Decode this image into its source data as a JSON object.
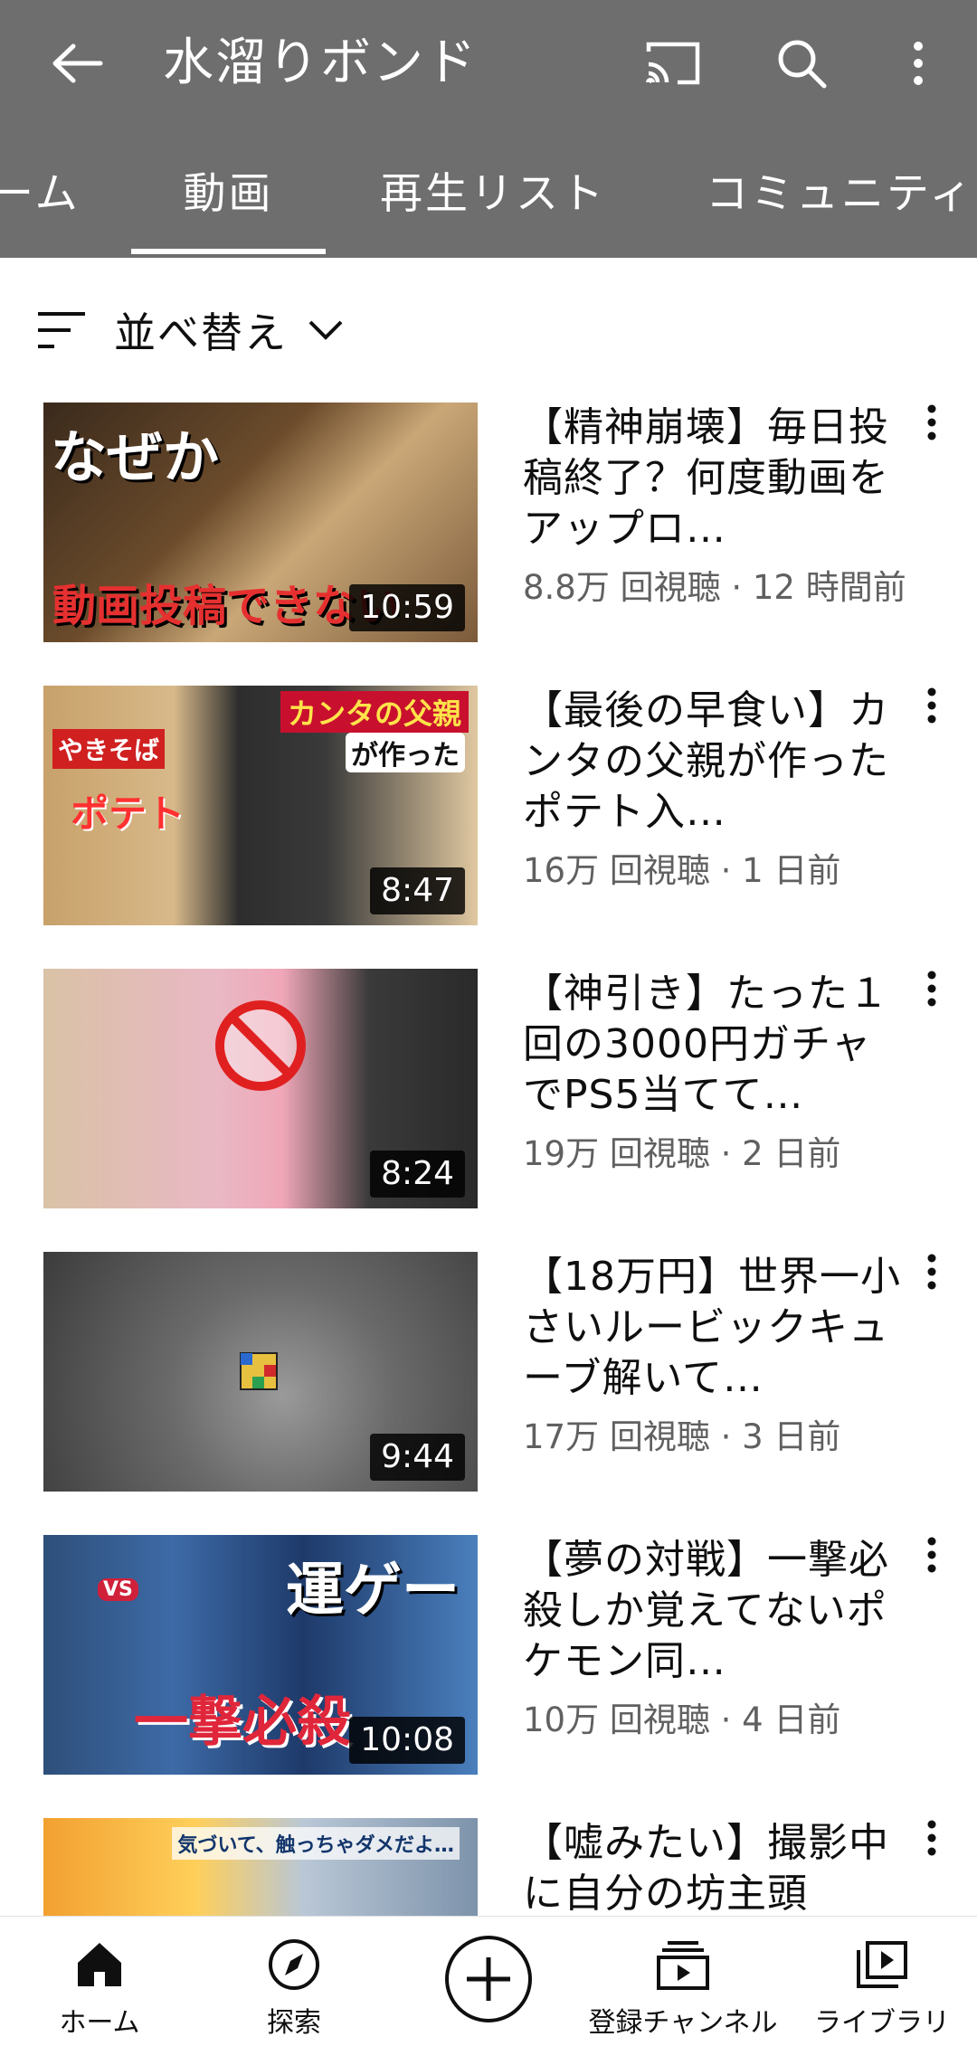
{
  "header": {
    "channel_title": "水溜りボンド",
    "back_icon": "arrow-left-icon",
    "cast_icon": "cast-icon",
    "search_icon": "search-icon",
    "more_icon": "more-vert-icon"
  },
  "tabs": [
    {
      "label": "ーム"
    },
    {
      "label": "動画",
      "selected": true
    },
    {
      "label": "再生リスト"
    },
    {
      "label": "コミュニティ"
    }
  ],
  "sort": {
    "label": "並べ替え",
    "icon": "sort-icon"
  },
  "videos": [
    {
      "title": "【精神崩壊】毎日投稿終了？何度動画をアップロ…",
      "views": "8.8万 回視聴",
      "age": "12 時間前",
      "meta": "8.8万 回視聴 · 12 時間前",
      "duration": "10:59",
      "thumb_text": [
        "なぜか",
        "動画投稿できない"
      ]
    },
    {
      "title": "【最後の早食い】カンタの父親が作ったポテト入…",
      "views": "16万 回視聴",
      "age": "1 日前",
      "meta": "16万 回視聴 · 1 日前",
      "duration": "8:47",
      "thumb_text": [
        "カンタの父親",
        "が作った",
        "やきそば",
        "ポテト"
      ]
    },
    {
      "title": "【神引き】たった１回の3000円ガチャでPS5当てて…",
      "views": "19万 回視聴",
      "age": "2 日前",
      "meta": "19万 回視聴 · 2 日前",
      "duration": "8:24",
      "thumb_text": []
    },
    {
      "title": "【18万円】世界一小さいルービックキューブ解いて…",
      "views": "17万 回視聴",
      "age": "3 日前",
      "meta": "17万 回視聴 · 3 日前",
      "duration": "9:44",
      "thumb_text": []
    },
    {
      "title": "【夢の対戦】一撃必殺しか覚えてないポケモン同…",
      "views": "10万 回視聴",
      "age": "4 日前",
      "meta": "10万 回視聴 · 4 日前",
      "duration": "10:08",
      "thumb_text": [
        "運ゲー",
        "一撃必殺",
        "VS"
      ]
    },
    {
      "title": "【嘘みたい】撮影中に自分の坊主頭",
      "views": "",
      "age": "",
      "meta": "",
      "duration": "",
      "thumb_text": [
        "気づいて、触っちゃダメだよ…"
      ]
    }
  ],
  "bottom_nav": [
    {
      "label": "ホーム",
      "icon": "home-icon",
      "active": true
    },
    {
      "label": "探索",
      "icon": "compass-icon"
    },
    {
      "label": "",
      "icon": "create-plus-icon"
    },
    {
      "label": "登録チャンネル",
      "icon": "subscriptions-icon"
    },
    {
      "label": "ライブラリ",
      "icon": "library-icon"
    }
  ],
  "colors": {
    "header_bg": "#6e6e6e",
    "header_fg": "#ffffff",
    "meta_text": "#606060",
    "background": "#ffffff"
  }
}
